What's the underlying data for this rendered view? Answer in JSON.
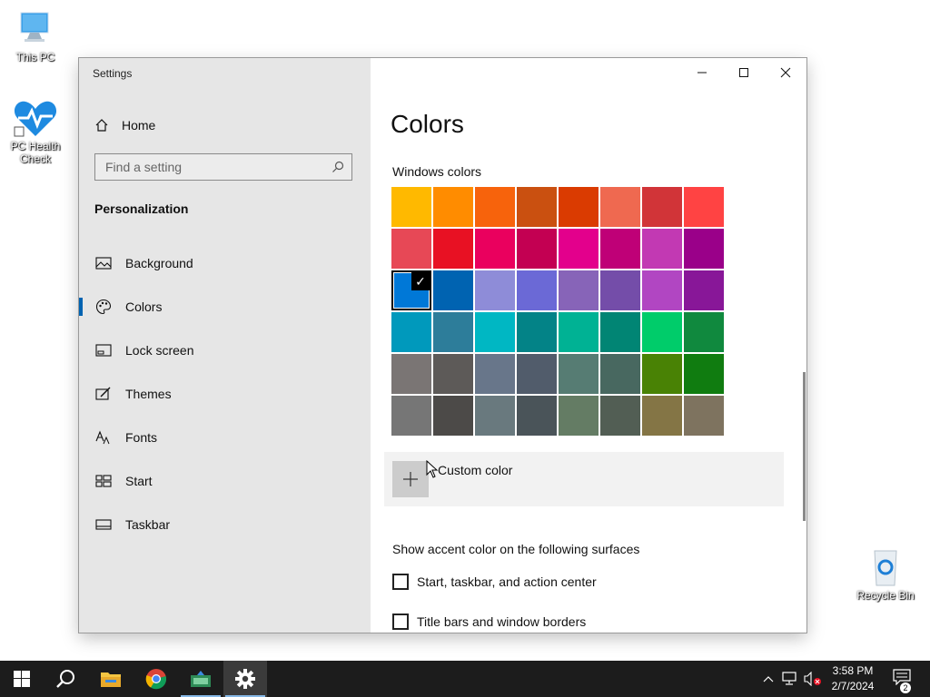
{
  "desktop": {
    "icons": [
      {
        "label": "This PC"
      },
      {
        "label": "PC Health Check"
      },
      {
        "label": "Recycle Bin"
      }
    ]
  },
  "window": {
    "title": "Settings",
    "controls": {
      "minimize": "minimize",
      "maximize": "maximize",
      "close": "close"
    }
  },
  "sidebar": {
    "home_label": "Home",
    "search_placeholder": "Find a setting",
    "section_title": "Personalization",
    "items": [
      {
        "label": "Background",
        "icon": "picture-icon"
      },
      {
        "label": "Colors",
        "icon": "palette-icon",
        "active": true
      },
      {
        "label": "Lock screen",
        "icon": "lock-screen-icon"
      },
      {
        "label": "Themes",
        "icon": "brush-icon"
      },
      {
        "label": "Fonts",
        "icon": "fonts-icon"
      },
      {
        "label": "Start",
        "icon": "start-layout-icon"
      },
      {
        "label": "Taskbar",
        "icon": "taskbar-icon"
      }
    ]
  },
  "main": {
    "title": "Colors",
    "windows_colors_label": "Windows colors",
    "swatches": [
      "#FFB900",
      "#FF8C00",
      "#F7630C",
      "#CA5010",
      "#DA3B01",
      "#EF6950",
      "#D13438",
      "#FF4343",
      "#E74856",
      "#E81123",
      "#EA005E",
      "#C30052",
      "#E3008C",
      "#BF0077",
      "#C239B3",
      "#9A0089",
      "#0078D7",
      "#0063B1",
      "#8E8CD8",
      "#6B69D6",
      "#8764B8",
      "#744DA9",
      "#B146C2",
      "#881798",
      "#0099BC",
      "#2D7D9A",
      "#00B7C3",
      "#038387",
      "#00B294",
      "#018574",
      "#00CC6A",
      "#10893E",
      "#7A7574",
      "#5D5A58",
      "#68768A",
      "#515C6B",
      "#567C73",
      "#486860",
      "#498205",
      "#107C10",
      "#767676",
      "#4C4A48",
      "#69797E",
      "#4A5459",
      "#647C64",
      "#525E54",
      "#847545",
      "#7E735F"
    ],
    "selected_swatch_index": 16,
    "custom_color_label": "Custom color",
    "accent_surfaces_label": "Show accent color on the following surfaces",
    "checkboxes": [
      {
        "label": "Start, taskbar, and action center",
        "checked": false
      },
      {
        "label": "Title bars and window borders",
        "checked": false
      }
    ]
  },
  "taskbar": {
    "apps": [
      "start-icon",
      "search-icon",
      "file-explorer-icon",
      "chrome-icon",
      "app-icon",
      "settings-icon"
    ],
    "time": "3:58 PM",
    "date": "2/7/2024",
    "notification_count": "2"
  },
  "colors": {
    "accent": "#0063B1",
    "sidebar_bg": "#E6E6E6",
    "taskbar_bg": "#1C1C1C"
  }
}
